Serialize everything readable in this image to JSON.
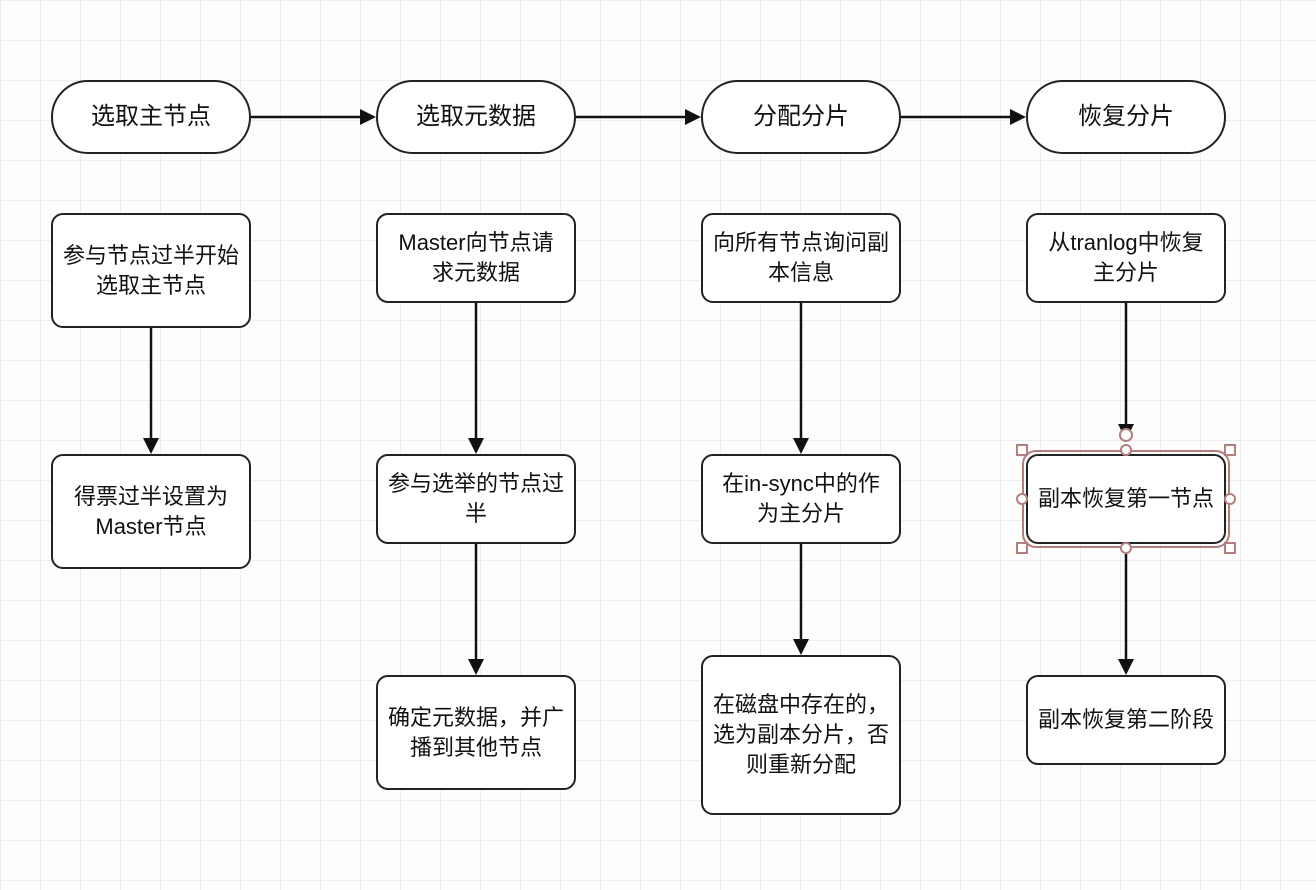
{
  "columns": [
    {
      "header": "选取主节点",
      "steps": [
        "参与节点过半开始选取主节点",
        "得票过半设置为Master节点"
      ]
    },
    {
      "header": "选取元数据",
      "steps": [
        "Master向节点请求元数据",
        "参与选举的节点过半",
        "确定元数据，并广播到其他节点"
      ]
    },
    {
      "header": "分配分片",
      "steps": [
        "向所有节点询问副本信息",
        "在in-sync中的作为主分片",
        "在磁盘中存在的，选为副本分片，否则重新分配"
      ]
    },
    {
      "header": "恢复分片",
      "steps": [
        "从tranlog中恢复主分片",
        "副本恢复第一节点",
        "副本恢复第二阶段"
      ]
    }
  ],
  "selected": {
    "column": 3,
    "step": 1
  }
}
